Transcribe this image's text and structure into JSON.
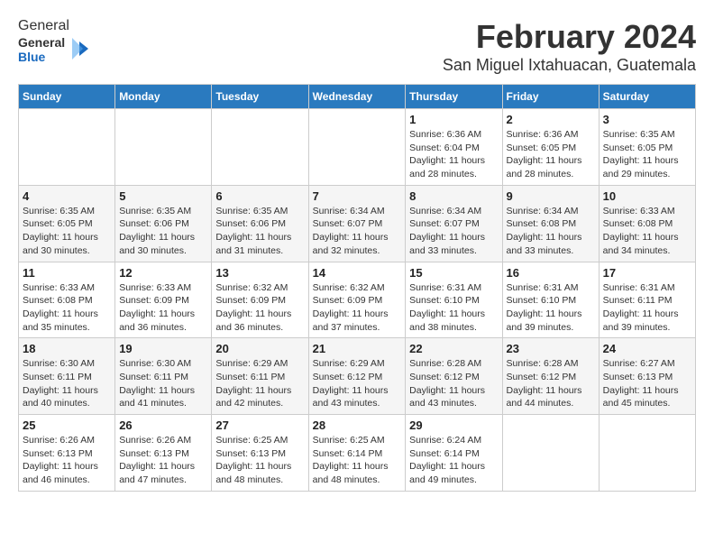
{
  "logo": {
    "general": "General",
    "blue": "Blue"
  },
  "title": "February 2024",
  "subtitle": "San Miguel Ixtahuacan, Guatemala",
  "days_of_week": [
    "Sunday",
    "Monday",
    "Tuesday",
    "Wednesday",
    "Thursday",
    "Friday",
    "Saturday"
  ],
  "weeks": [
    [
      {
        "day": "",
        "detail": ""
      },
      {
        "day": "",
        "detail": ""
      },
      {
        "day": "",
        "detail": ""
      },
      {
        "day": "",
        "detail": ""
      },
      {
        "day": "1",
        "detail": "Sunrise: 6:36 AM\nSunset: 6:04 PM\nDaylight: 11 hours and 28 minutes."
      },
      {
        "day": "2",
        "detail": "Sunrise: 6:36 AM\nSunset: 6:05 PM\nDaylight: 11 hours and 28 minutes."
      },
      {
        "day": "3",
        "detail": "Sunrise: 6:35 AM\nSunset: 6:05 PM\nDaylight: 11 hours and 29 minutes."
      }
    ],
    [
      {
        "day": "4",
        "detail": "Sunrise: 6:35 AM\nSunset: 6:05 PM\nDaylight: 11 hours and 30 minutes."
      },
      {
        "day": "5",
        "detail": "Sunrise: 6:35 AM\nSunset: 6:06 PM\nDaylight: 11 hours and 30 minutes."
      },
      {
        "day": "6",
        "detail": "Sunrise: 6:35 AM\nSunset: 6:06 PM\nDaylight: 11 hours and 31 minutes."
      },
      {
        "day": "7",
        "detail": "Sunrise: 6:34 AM\nSunset: 6:07 PM\nDaylight: 11 hours and 32 minutes."
      },
      {
        "day": "8",
        "detail": "Sunrise: 6:34 AM\nSunset: 6:07 PM\nDaylight: 11 hours and 33 minutes."
      },
      {
        "day": "9",
        "detail": "Sunrise: 6:34 AM\nSunset: 6:08 PM\nDaylight: 11 hours and 33 minutes."
      },
      {
        "day": "10",
        "detail": "Sunrise: 6:33 AM\nSunset: 6:08 PM\nDaylight: 11 hours and 34 minutes."
      }
    ],
    [
      {
        "day": "11",
        "detail": "Sunrise: 6:33 AM\nSunset: 6:08 PM\nDaylight: 11 hours and 35 minutes."
      },
      {
        "day": "12",
        "detail": "Sunrise: 6:33 AM\nSunset: 6:09 PM\nDaylight: 11 hours and 36 minutes."
      },
      {
        "day": "13",
        "detail": "Sunrise: 6:32 AM\nSunset: 6:09 PM\nDaylight: 11 hours and 36 minutes."
      },
      {
        "day": "14",
        "detail": "Sunrise: 6:32 AM\nSunset: 6:09 PM\nDaylight: 11 hours and 37 minutes."
      },
      {
        "day": "15",
        "detail": "Sunrise: 6:31 AM\nSunset: 6:10 PM\nDaylight: 11 hours and 38 minutes."
      },
      {
        "day": "16",
        "detail": "Sunrise: 6:31 AM\nSunset: 6:10 PM\nDaylight: 11 hours and 39 minutes."
      },
      {
        "day": "17",
        "detail": "Sunrise: 6:31 AM\nSunset: 6:11 PM\nDaylight: 11 hours and 39 minutes."
      }
    ],
    [
      {
        "day": "18",
        "detail": "Sunrise: 6:30 AM\nSunset: 6:11 PM\nDaylight: 11 hours and 40 minutes."
      },
      {
        "day": "19",
        "detail": "Sunrise: 6:30 AM\nSunset: 6:11 PM\nDaylight: 11 hours and 41 minutes."
      },
      {
        "day": "20",
        "detail": "Sunrise: 6:29 AM\nSunset: 6:11 PM\nDaylight: 11 hours and 42 minutes."
      },
      {
        "day": "21",
        "detail": "Sunrise: 6:29 AM\nSunset: 6:12 PM\nDaylight: 11 hours and 43 minutes."
      },
      {
        "day": "22",
        "detail": "Sunrise: 6:28 AM\nSunset: 6:12 PM\nDaylight: 11 hours and 43 minutes."
      },
      {
        "day": "23",
        "detail": "Sunrise: 6:28 AM\nSunset: 6:12 PM\nDaylight: 11 hours and 44 minutes."
      },
      {
        "day": "24",
        "detail": "Sunrise: 6:27 AM\nSunset: 6:13 PM\nDaylight: 11 hours and 45 minutes."
      }
    ],
    [
      {
        "day": "25",
        "detail": "Sunrise: 6:26 AM\nSunset: 6:13 PM\nDaylight: 11 hours and 46 minutes."
      },
      {
        "day": "26",
        "detail": "Sunrise: 6:26 AM\nSunset: 6:13 PM\nDaylight: 11 hours and 47 minutes."
      },
      {
        "day": "27",
        "detail": "Sunrise: 6:25 AM\nSunset: 6:13 PM\nDaylight: 11 hours and 48 minutes."
      },
      {
        "day": "28",
        "detail": "Sunrise: 6:25 AM\nSunset: 6:14 PM\nDaylight: 11 hours and 48 minutes."
      },
      {
        "day": "29",
        "detail": "Sunrise: 6:24 AM\nSunset: 6:14 PM\nDaylight: 11 hours and 49 minutes."
      },
      {
        "day": "",
        "detail": ""
      },
      {
        "day": "",
        "detail": ""
      }
    ]
  ]
}
